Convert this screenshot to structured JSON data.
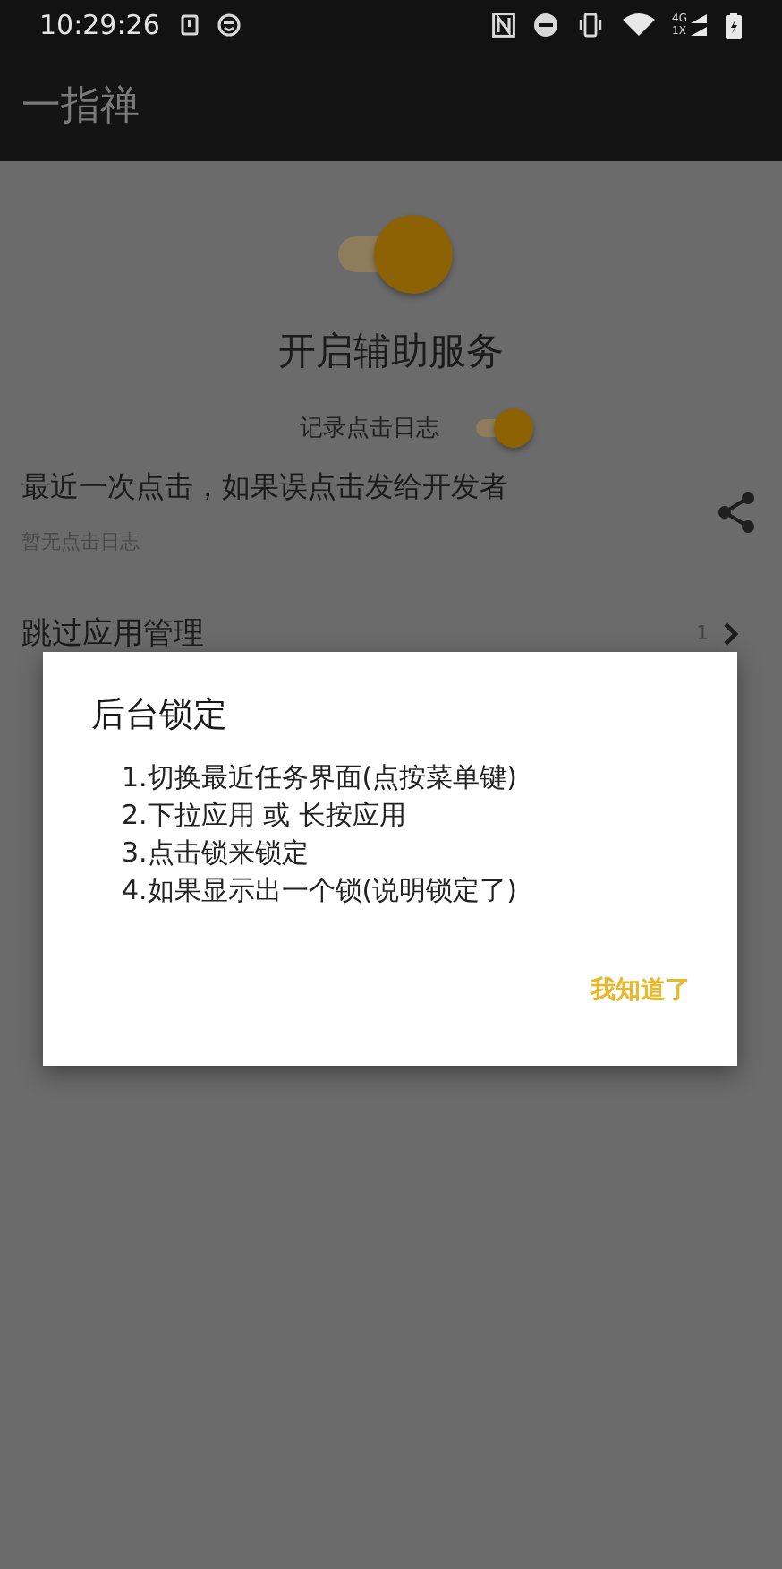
{
  "status_bar": {
    "time": "10:29:26",
    "network_top": "4G",
    "network_bottom": "1X"
  },
  "app_bar": {
    "title": "一指禅"
  },
  "service": {
    "on": true,
    "title": "开启辅助服务",
    "log_label": "记录点击日志",
    "log_on": true
  },
  "last_click": {
    "title": "最近一次点击，如果误点击发给开发者",
    "subtitle": "暂无点击日志"
  },
  "skip_apps": {
    "title": "跳过应用管理",
    "count": "1"
  },
  "dialog": {
    "title": "后台锁定",
    "lines": [
      "1.切换最近任务界面(点按菜单键)",
      "2.下拉应用 或 长按应用",
      "3.点击锁来锁定",
      "4.如果显示出一个锁(说明锁定了)"
    ],
    "button": "我知道了"
  }
}
